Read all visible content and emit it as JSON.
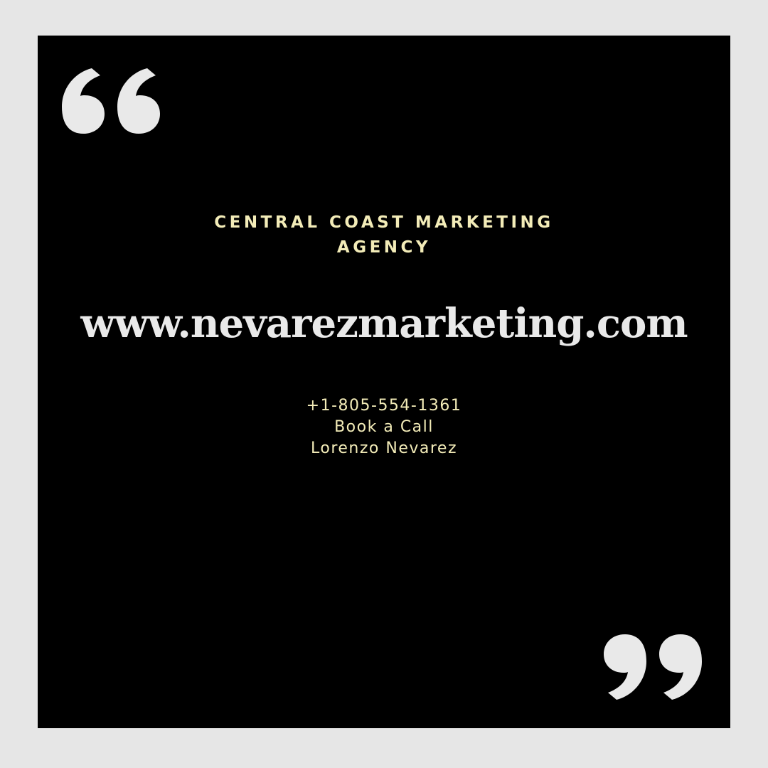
{
  "colors": {
    "page_background": "#e6e6e6",
    "card_background": "#000000",
    "accent_text": "#f3ecb8",
    "website_text": "#e9e9e9",
    "quote_marks": "#e9e9e9"
  },
  "icons": {
    "open_quote": "open-quote-icon",
    "close_quote": "close-quote-icon"
  },
  "agency": {
    "line1": "CENTRAL COAST MARKETING",
    "line2": "AGENCY"
  },
  "website": "www.nevarezmarketing.com",
  "contact": {
    "phone": "+1-805-554-1361",
    "cta": "Book a Call",
    "name": "Lorenzo Nevarez"
  }
}
